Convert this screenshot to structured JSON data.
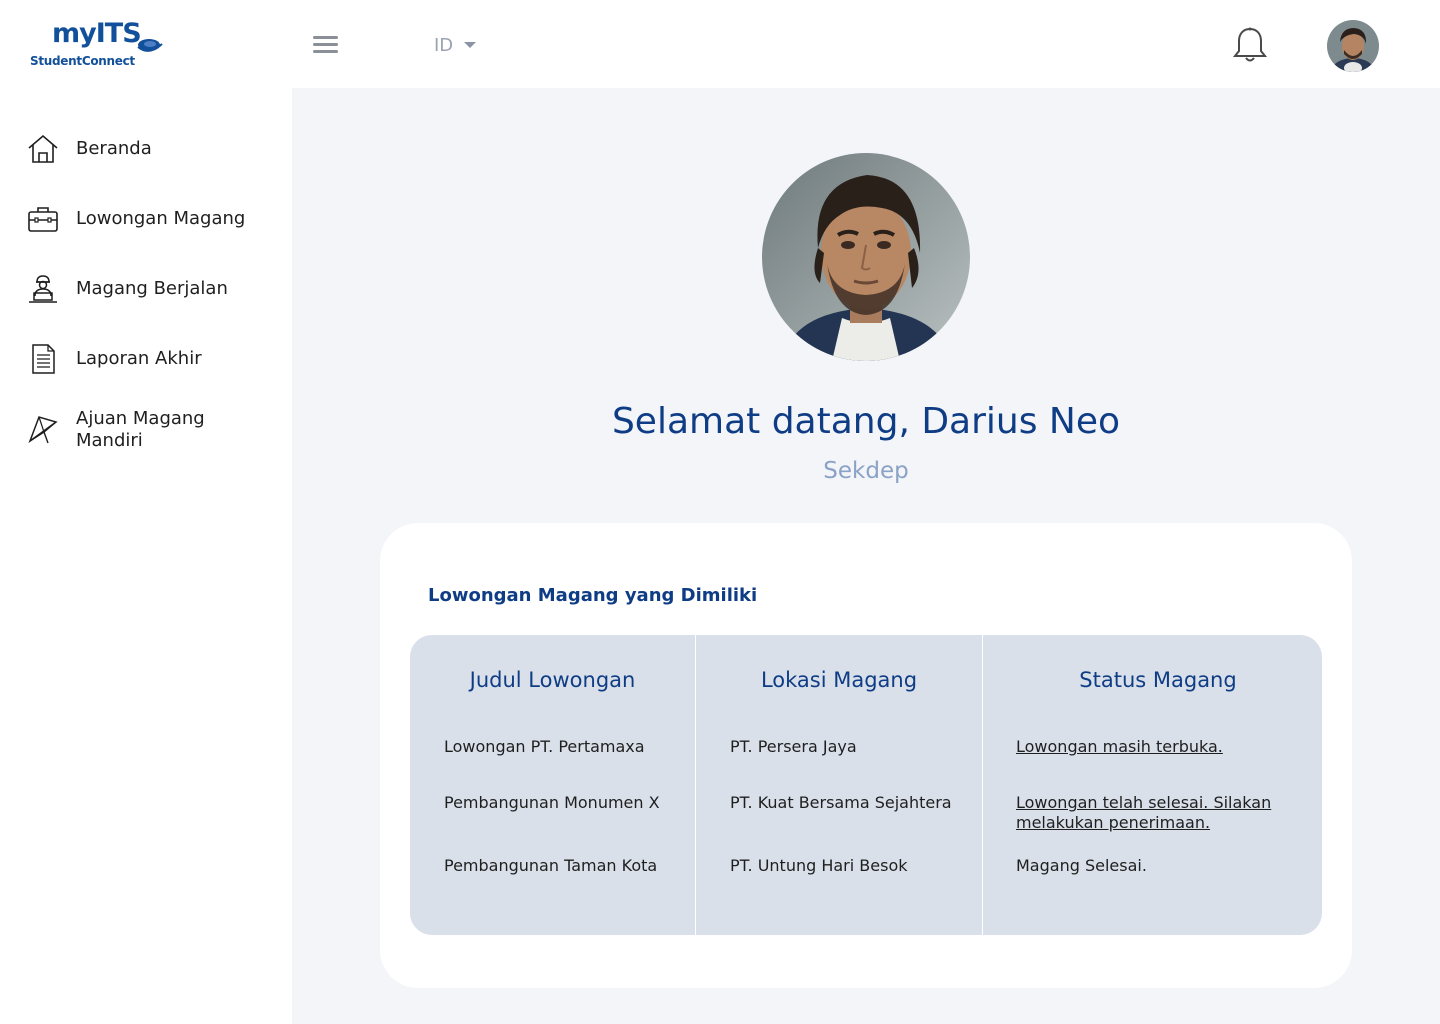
{
  "header": {
    "logo_main": "myITS",
    "logo_sub": "StudentConnect",
    "language": "ID"
  },
  "sidebar": {
    "items": [
      {
        "label": "Beranda",
        "icon": "home-icon"
      },
      {
        "label": "Lowongan Magang",
        "icon": "briefcase-icon"
      },
      {
        "label": "Magang Berjalan",
        "icon": "worker-laptop-icon"
      },
      {
        "label": "Laporan Akhir",
        "icon": "document-icon"
      },
      {
        "label": "Ajuan Magang Mandiri",
        "icon": "paper-plane-icon"
      }
    ]
  },
  "main": {
    "welcome": "Selamat datang, Darius Neo",
    "role": "Sekdep",
    "card": {
      "title": "Lowongan Magang yang Dimiliki",
      "columns": [
        "Judul Lowongan",
        "Lokasi Magang",
        "Status Magang"
      ],
      "rows": [
        {
          "title": "Lowongan PT. Pertamaxa",
          "location": "PT. Persera Jaya",
          "status": "Lowongan masih terbuka."
        },
        {
          "title": "Pembangunan Monumen X",
          "location": "PT. Kuat Bersama Sejahtera",
          "status": "Lowongan telah selesai. Silakan melakukan penerimaan."
        },
        {
          "title": "Pembangunan Taman Kota",
          "location": "PT. Untung Hari Besok",
          "status": "Magang Selesai."
        }
      ]
    }
  },
  "colors": {
    "primary": "#0f3d85",
    "role_text": "#8aa2c6",
    "main_bg": "#f4f5f9",
    "table_bg": "#d9e0ea"
  }
}
